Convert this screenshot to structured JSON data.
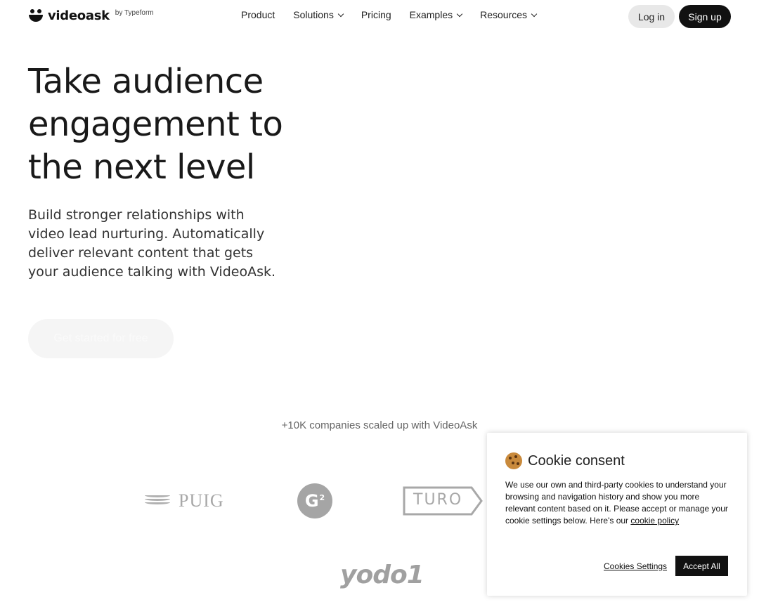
{
  "header": {
    "logo_text": "videoask",
    "logo_by": "by Typeform",
    "nav": [
      {
        "label": "Product",
        "has_dropdown": false
      },
      {
        "label": "Solutions",
        "has_dropdown": true
      },
      {
        "label": "Pricing",
        "has_dropdown": false
      },
      {
        "label": "Examples",
        "has_dropdown": true
      },
      {
        "label": "Resources",
        "has_dropdown": true
      }
    ],
    "login_label": "Log in",
    "signup_label": "Sign up"
  },
  "hero": {
    "title_lines": [
      "Take audience",
      "engagement to",
      "the next level"
    ],
    "subtitle_lines": [
      "Build stronger relationships with",
      "video lead nurturing. Automatically",
      "deliver relevant content that gets",
      "your audience talking with VideoAsk."
    ],
    "cta_label": "Get started for free"
  },
  "proof": {
    "text": "+10K companies scaled up with VideoAsk",
    "logos": {
      "puig": "PUIG",
      "g2": "G",
      "g2_sup": "2",
      "turo": "TURO",
      "yodo": "yodo1"
    }
  },
  "cookie": {
    "title": "Cookie consent",
    "body": "We use our own and third-party cookies to understand your browsing and navigation history and show you more relevant content based on it. Please accept or manage your cookie settings below. Here's our ",
    "link_label": "cookie policy",
    "settings_label": "Cookies Settings",
    "accept_label": "Accept All"
  },
  "colors": {
    "accent_dark": "#111111",
    "login_bg": "#e8e8e8",
    "logo_gray": "#a8a8a8"
  }
}
